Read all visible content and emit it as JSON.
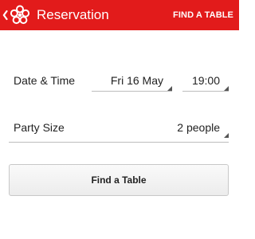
{
  "colors": {
    "brand": "#e21b1b",
    "text": "#222222",
    "divider": "#bdbdbd"
  },
  "header": {
    "title": "Reservation",
    "action_label": "FIND A TABLE",
    "back_icon": "chevron-left-icon",
    "logo_icon": "flower-logo-icon"
  },
  "form": {
    "date_time": {
      "label": "Date & Time",
      "date": "Fri 16 May",
      "time": "19:00"
    },
    "party_size": {
      "label": "Party Size",
      "value": "2 people"
    }
  },
  "button": {
    "label": "Find a Table"
  }
}
